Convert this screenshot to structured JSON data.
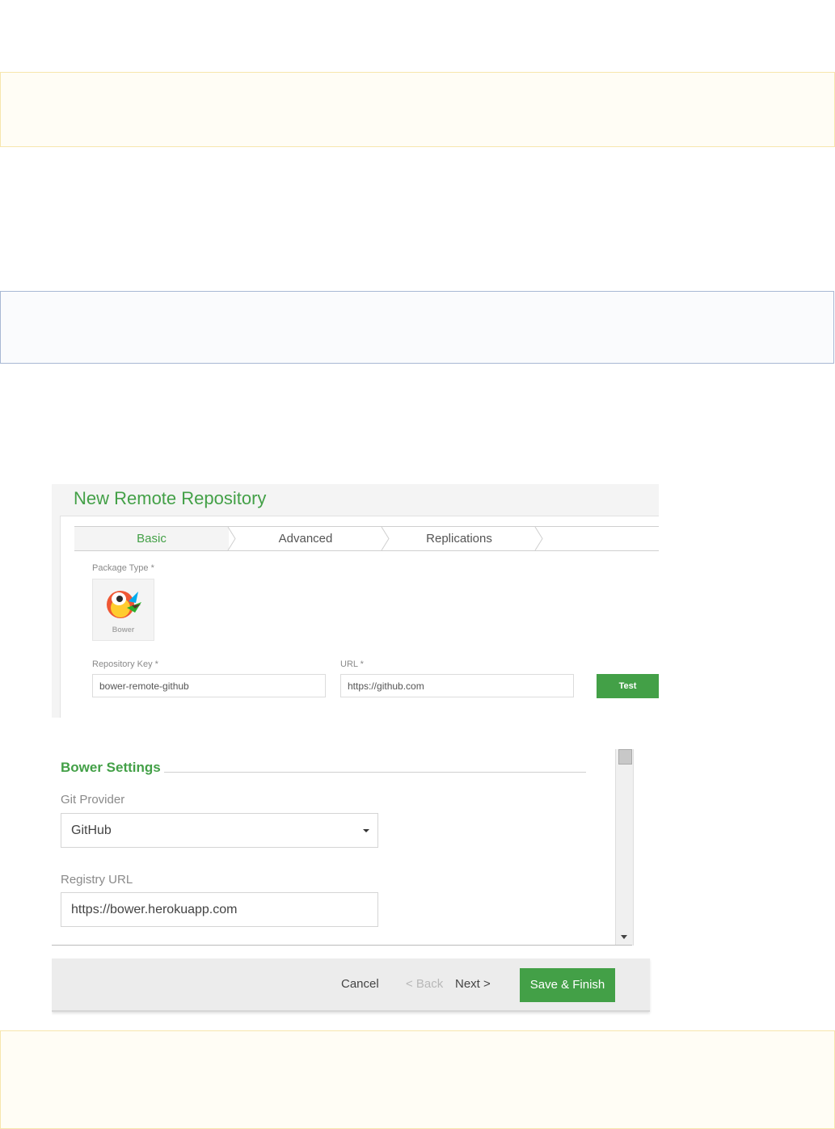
{
  "wizard": {
    "title": "New Remote Repository",
    "tabs": [
      {
        "label": "Basic",
        "active": true
      },
      {
        "label": "Advanced",
        "active": false
      },
      {
        "label": "Replications",
        "active": false
      }
    ],
    "package_type_label": "Package Type *",
    "package_type": {
      "name": "Bower",
      "icon": "bower-bird-icon"
    },
    "repository_key_label": "Repository Key *",
    "repository_key_value": "bower-remote-github",
    "url_label": "URL *",
    "url_value": "https://github.com",
    "test_button": "Test"
  },
  "bower_settings": {
    "section_title": "Bower Settings",
    "git_provider_label": "Git Provider",
    "git_provider_value": "GitHub",
    "registry_url_label": "Registry URL",
    "registry_url_value": "https://bower.herokuapp.com"
  },
  "footer": {
    "cancel": "Cancel",
    "back": "< Back",
    "next": "Next >",
    "save_finish": "Save & Finish"
  },
  "colors": {
    "accent_green": "#43a047",
    "note_border": "#f7e6ad",
    "info_border": "#a8b8d4"
  }
}
